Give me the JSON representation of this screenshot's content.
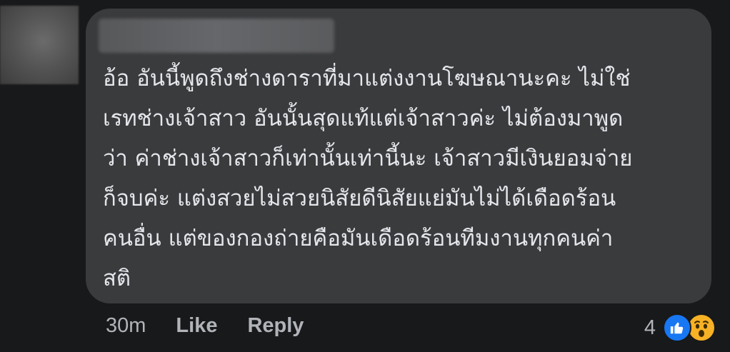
{
  "comment": {
    "text": "อ้อ อันนี้พูดถึงช่างดาราที่มาแต่งงานโฆษณานะคะ ไม่ใช่\nเรทช่างเจ้าสาว อันนั้นสุดแท้แต่เจ้าสาวค่ะ ไม่ต้องมาพูด\nว่า ค่าช่างเจ้าสาวก็เท่านั้นเท่านี้นะ เจ้าสาวมีเงินยอมจ่าย\nก็จบค่ะ แต่งสวยไม่สวยนิสัยดีนิสัยแย่มันไม่ได้เดือดร้อน\nคนอื่น แต่ของกองถ่ายคือมันเดือดร้อนทีมงานทุกคนค่า\nสติ"
  },
  "actions": {
    "time": "30m",
    "like_label": "Like",
    "reply_label": "Reply"
  },
  "reactions": {
    "count": "4",
    "icons": [
      "like-icon",
      "wow-icon"
    ]
  },
  "colors": {
    "background": "#18191a",
    "bubble": "#3a3b3c",
    "text": "#e4e6eb",
    "secondary_text": "#b0b3b8",
    "like_blue": "#1877f2",
    "wow_yellow": "#f7b125"
  }
}
